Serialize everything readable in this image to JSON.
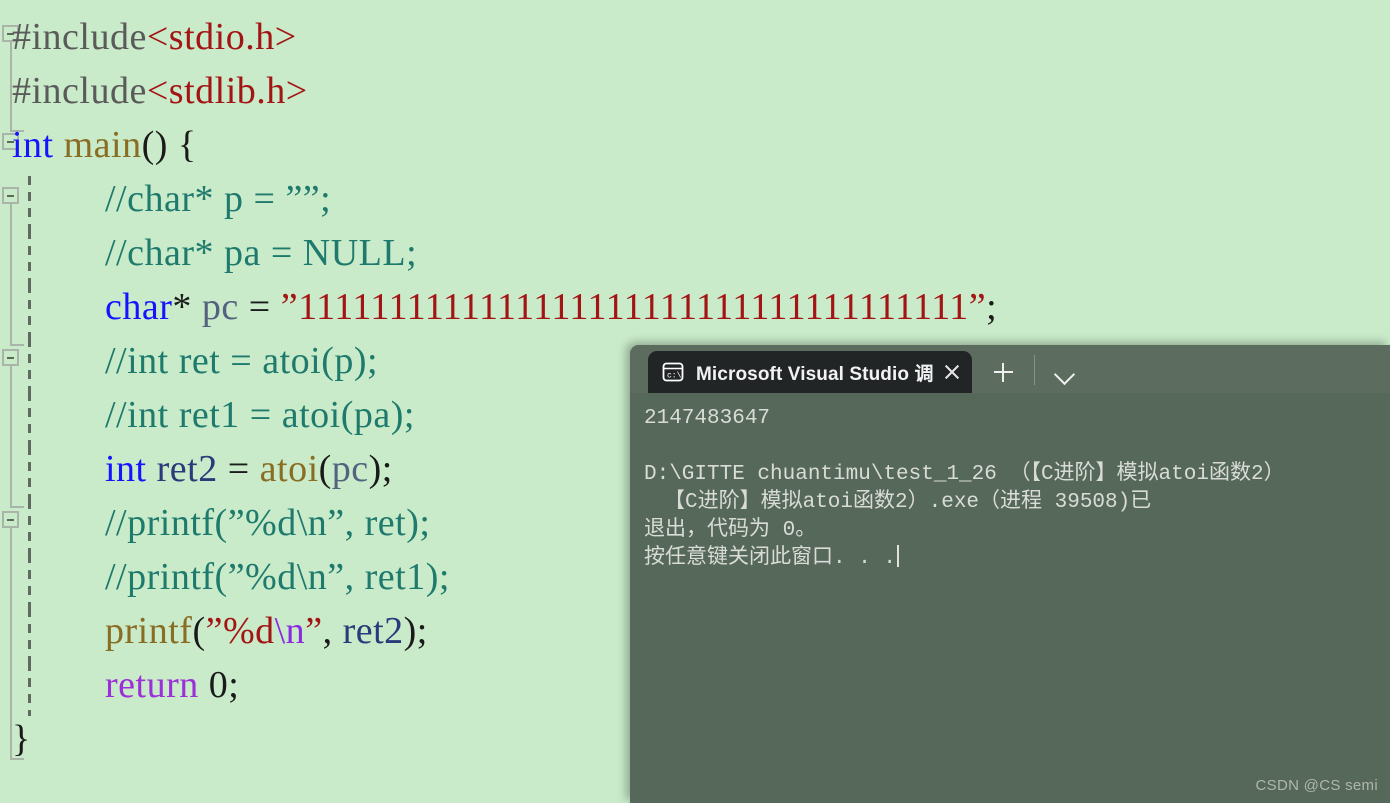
{
  "editor": {
    "background_color": "#c9ebc9",
    "code_lines": [
      {
        "id": "line-1",
        "indent": false,
        "fold": "box",
        "tokens": [
          {
            "cls": "tok-pp",
            "text": "#include"
          },
          {
            "cls": "tok-header",
            "text": "<stdio.h>"
          }
        ]
      },
      {
        "id": "line-2",
        "indent": false,
        "fold": "vline",
        "tokens": [
          {
            "cls": "tok-pp",
            "text": "#include"
          },
          {
            "cls": "tok-header",
            "text": "<stdlib.h>"
          }
        ]
      },
      {
        "id": "line-3",
        "indent": false,
        "fold": "box",
        "tokens": [
          {
            "cls": "tok-kw",
            "text": "int"
          },
          {
            "cls": "tok-plain",
            "text": " "
          },
          {
            "cls": "tok-fn",
            "text": "main"
          },
          {
            "cls": "tok-plain",
            "text": "() {"
          }
        ]
      },
      {
        "id": "line-4",
        "indent": true,
        "fold": "box",
        "tokens": [
          {
            "cls": "tok-comment",
            "text": "//char* p = "
          },
          {
            "cls": "tok-comment",
            "text": "””"
          },
          {
            "cls": "tok-comment",
            "text": ";"
          }
        ]
      },
      {
        "id": "line-5",
        "indent": true,
        "fold": "none",
        "tokens": [
          {
            "cls": "tok-comment",
            "text": "//char* pa = NULL;"
          }
        ]
      },
      {
        "id": "line-6",
        "indent": true,
        "fold": "none",
        "tokens": [
          {
            "cls": "tok-kw",
            "text": "char"
          },
          {
            "cls": "tok-plain",
            "text": "* "
          },
          {
            "cls": "tok-var2",
            "text": "pc"
          },
          {
            "cls": "tok-plain",
            "text": " = "
          },
          {
            "cls": "tok-string",
            "text": "”1111111111111111111111111111111111111”"
          },
          {
            "cls": "tok-plain",
            "text": ";"
          }
        ]
      },
      {
        "id": "line-7",
        "indent": true,
        "fold": "box",
        "tokens": [
          {
            "cls": "tok-comment",
            "text": "//int ret = atoi(p);"
          }
        ]
      },
      {
        "id": "line-8",
        "indent": true,
        "fold": "none",
        "tokens": [
          {
            "cls": "tok-comment",
            "text": "//int ret1 = atoi(pa);"
          }
        ]
      },
      {
        "id": "line-9",
        "indent": true,
        "fold": "none",
        "tokens": [
          {
            "cls": "tok-kw",
            "text": "int"
          },
          {
            "cls": "tok-plain",
            "text": " "
          },
          {
            "cls": "tok-var",
            "text": "ret2"
          },
          {
            "cls": "tok-plain",
            "text": " = "
          },
          {
            "cls": "tok-fn",
            "text": "atoi"
          },
          {
            "cls": "tok-plain",
            "text": "("
          },
          {
            "cls": "tok-var2",
            "text": "pc"
          },
          {
            "cls": "tok-plain",
            "text": ");"
          }
        ]
      },
      {
        "id": "line-10",
        "indent": true,
        "fold": "box",
        "tokens": [
          {
            "cls": "tok-comment",
            "text": "//printf(”%d\\n”, ret);"
          }
        ]
      },
      {
        "id": "line-11",
        "indent": true,
        "fold": "none",
        "tokens": [
          {
            "cls": "tok-comment",
            "text": "//printf(”%d\\n”, ret1);"
          }
        ]
      },
      {
        "id": "line-12",
        "indent": true,
        "fold": "none",
        "tokens": [
          {
            "cls": "tok-fn",
            "text": "printf"
          },
          {
            "cls": "tok-plain",
            "text": "("
          },
          {
            "cls": "tok-string",
            "text": "”%d"
          },
          {
            "cls": "tok-esc",
            "text": "\\n"
          },
          {
            "cls": "tok-string",
            "text": "”"
          },
          {
            "cls": "tok-plain",
            "text": ", "
          },
          {
            "cls": "tok-var",
            "text": "ret2"
          },
          {
            "cls": "tok-plain",
            "text": ");"
          }
        ]
      },
      {
        "id": "line-13",
        "indent": true,
        "fold": "none",
        "tokens": [
          {
            "cls": "tok-kwmag",
            "text": "return"
          },
          {
            "cls": "tok-plain",
            "text": " "
          },
          {
            "cls": "tok-num",
            "text": "0"
          },
          {
            "cls": "tok-plain",
            "text": ";"
          }
        ]
      },
      {
        "id": "line-14",
        "indent": false,
        "fold": "end",
        "tokens": [
          {
            "cls": "tok-plain",
            "text": "}"
          }
        ]
      }
    ]
  },
  "console": {
    "title_bar": {
      "tab_title": "Microsoft Visual Studio 调试控",
      "tab_icon": "console-cmd-icon",
      "close_icon": "close-icon",
      "new_tab_icon": "plus-icon",
      "dropdown_icon": "chevron-down-icon"
    },
    "background_color": "#56685a",
    "titlebar_color": "#5c6d5f",
    "tab_color": "#222526",
    "output_lines": [
      {
        "text": "2147483647",
        "indent": false
      },
      {
        "text": "",
        "indent": false
      },
      {
        "text": "D:\\GITTE chuantimu\\test_1_26 （【C进阶】模拟atoi函数2）",
        "indent": false
      },
      {
        "text": "【C进阶】模拟atoi函数2）.exe（进程 39508)已",
        "indent": true
      },
      {
        "text": "退出，代码为 0。",
        "indent": false
      },
      {
        "text": "按任意键关闭此窗口. . .",
        "indent": false,
        "caret": true
      }
    ]
  },
  "watermark": {
    "text": "CSDN @CS semi"
  }
}
